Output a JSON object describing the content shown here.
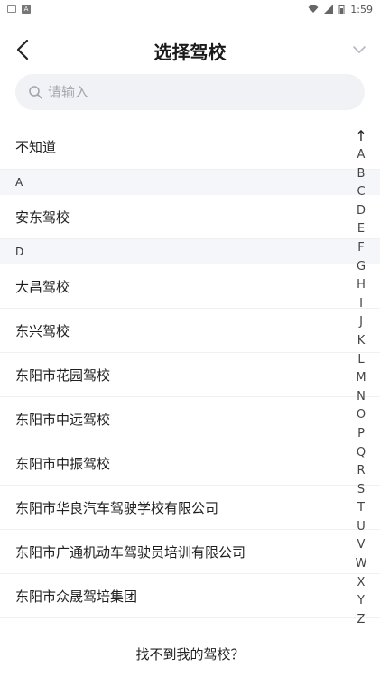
{
  "status": {
    "time": "1:59",
    "app_icon": "A"
  },
  "nav": {
    "title": "选择驾校"
  },
  "search": {
    "placeholder": "请输入"
  },
  "list": {
    "top_item": "不知道",
    "sections": [
      {
        "letter": "A",
        "items": [
          "安东驾校"
        ]
      },
      {
        "letter": "D",
        "items": [
          "大昌驾校",
          "东兴驾校",
          "东阳市花园驾校",
          "东阳市中远驾校",
          "东阳市中振驾校",
          "东阳市华良汽车驾驶学校有限公司",
          "东阳市广通机动车驾驶员培训有限公司",
          "东阳市众晟驾培集团"
        ]
      }
    ]
  },
  "index": {
    "top_arrow": "↑",
    "letters": [
      "A",
      "B",
      "C",
      "D",
      "E",
      "F",
      "G",
      "H",
      "I",
      "J",
      "K",
      "L",
      "M",
      "N",
      "O",
      "P",
      "Q",
      "R",
      "S",
      "T",
      "U",
      "V",
      "W",
      "X",
      "Y",
      "Z"
    ]
  },
  "footer": {
    "text": "找不到我的驾校？"
  },
  "colors": {
    "search_bg": "#f1f2f6",
    "section_bg": "#f5f6f9"
  }
}
